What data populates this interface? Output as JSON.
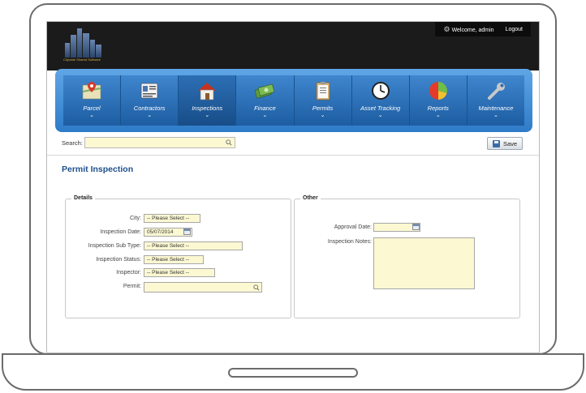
{
  "app": {
    "logo_caption": "Citywide Shared Software"
  },
  "user_bar": {
    "welcome": "Welcome, admin",
    "logout": "Logout"
  },
  "nav": {
    "items": [
      {
        "label": "Parcel",
        "icon": "map-pin-icon"
      },
      {
        "label": "Contractors",
        "icon": "contractor-card-icon"
      },
      {
        "label": "Inspections",
        "icon": "house-icon"
      },
      {
        "label": "Finance",
        "icon": "money-icon"
      },
      {
        "label": "Permits",
        "icon": "clipboard-icon"
      },
      {
        "label": "Asset Tracking",
        "icon": "clock-icon"
      },
      {
        "label": "Reports",
        "icon": "pie-chart-icon"
      },
      {
        "label": "Maintenance",
        "icon": "wrench-icon"
      }
    ],
    "active": "Inspections"
  },
  "toolbar": {
    "search_label": "Search:",
    "search_value": "",
    "save_label": "Save"
  },
  "page": {
    "title": "Permit Inspection"
  },
  "details": {
    "legend": "Details",
    "city_label": "City:",
    "city_value": "-- Please Select --",
    "inspection_date_label": "Inspection Date:",
    "inspection_date_value": "05/07/2014",
    "sub_type_label": "Inspection Sub Type:",
    "sub_type_value": "-- Please Select --",
    "status_label": "Inspection Status:",
    "status_value": "-- Please Select --",
    "inspector_label": "Inspector:",
    "inspector_value": "-- Please Select --",
    "permit_label": "Permit:",
    "permit_value": ""
  },
  "other": {
    "legend": "Other",
    "approval_date_label": "Approval Date:",
    "approval_date_value": "",
    "notes_label": "Inspection Notes:",
    "notes_value": ""
  },
  "colors": {
    "nav_blue": "#2e7bc8",
    "field_yellow": "#fbf8d2",
    "title_blue": "#1e4f8c"
  }
}
